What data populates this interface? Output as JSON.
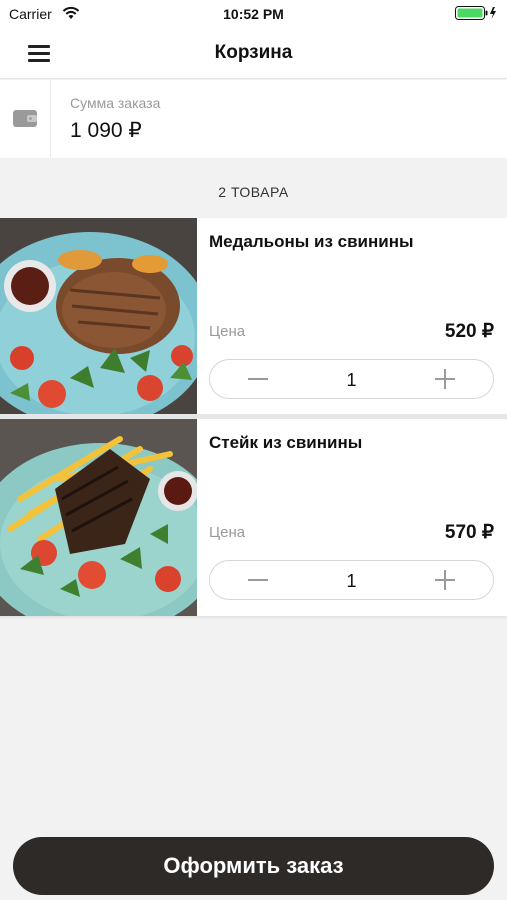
{
  "status_bar": {
    "carrier": "Carrier",
    "time": "10:52 PM"
  },
  "header": {
    "title": "Корзина",
    "menu_icon": "hamburger-menu-icon"
  },
  "summary": {
    "label": "Сумма заказа",
    "value": "1 090 ₽",
    "icon": "wallet-icon"
  },
  "cart": {
    "count_label": "2 ТОВАРА",
    "items": [
      {
        "name": "Медальоны из свинины",
        "price_label": "Цена",
        "price": "520 ₽",
        "quantity": "1"
      },
      {
        "name": "Стейк из свинины",
        "price_label": "Цена",
        "price": "570 ₽",
        "quantity": "1"
      }
    ]
  },
  "checkout": {
    "label": "Оформить заказ"
  },
  "colors": {
    "checkout_bg": "#2e2a28",
    "background": "#f2f2f2",
    "battery": "#4cd964"
  }
}
